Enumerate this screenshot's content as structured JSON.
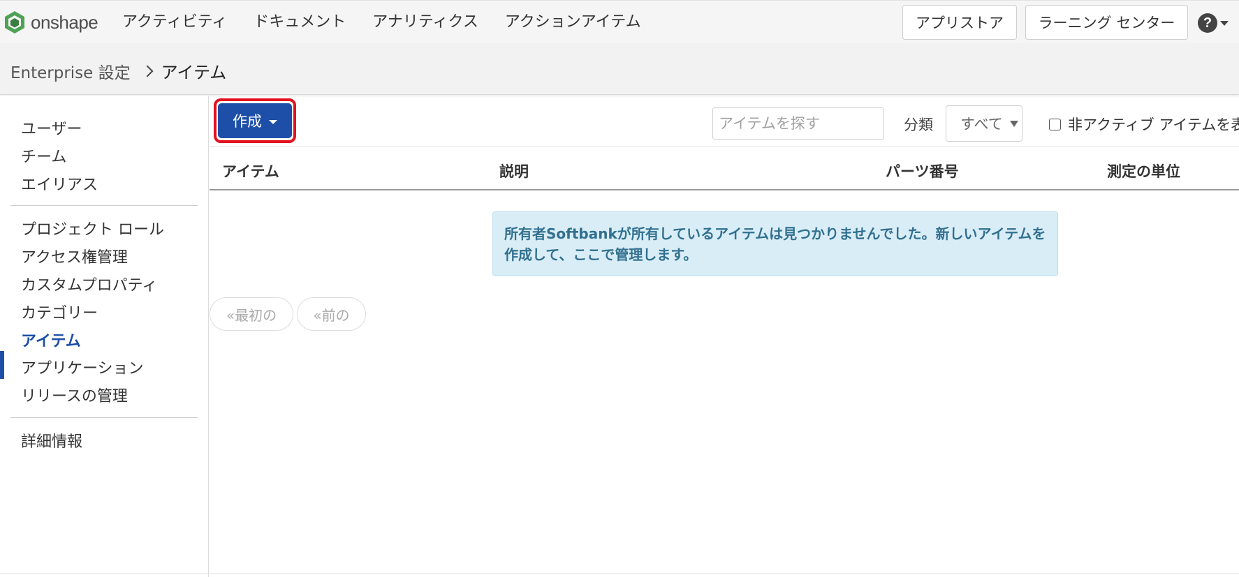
{
  "topbar": {
    "logo_text": "onshape",
    "nav": [
      "アクティビティ",
      "ドキュメント",
      "アナリティクス",
      "アクションアイテム"
    ],
    "appstore_label": "アプリストア",
    "learning_label": "ラーニング センター",
    "help_icon": "?"
  },
  "breadcrumb": {
    "root": "Enterprise 設定",
    "current": "アイテム"
  },
  "sidebar": {
    "group1": [
      "ユーザー",
      "チーム",
      "エイリアス"
    ],
    "group2": [
      "プロジェクト ロール",
      "アクセス権管理",
      "カスタムプロパティ",
      "カテゴリー",
      "アイテム",
      "アプリケーション",
      "リリースの管理"
    ],
    "group3": [
      "詳細情報"
    ],
    "active": "アイテム"
  },
  "toolbar": {
    "create_label": "作成",
    "search_placeholder": "アイテムを探す",
    "category_label": "分類",
    "category_value": "すべて",
    "inactive_label": "非アクティブ アイテムを表"
  },
  "table": {
    "columns": [
      "アイテム",
      "説明",
      "パーツ番号",
      "測定の単位"
    ]
  },
  "notice": "所有者Softbankが所有しているアイテムは見つかりませんでした。新しいアイテムを作成して、ここで管理します。",
  "pager": {
    "first": "«最初の",
    "prev": "«前の"
  },
  "colors": {
    "accent": "#1d4fa8",
    "highlight": "#e2121f",
    "notice_bg": "#d9edf7",
    "notice_text": "#31708f"
  }
}
